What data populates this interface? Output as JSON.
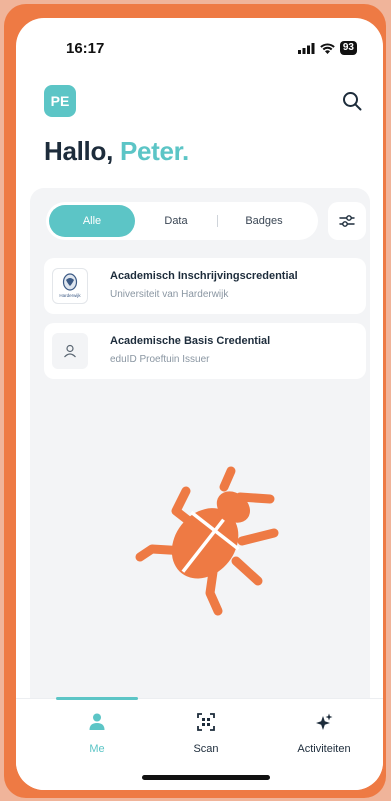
{
  "status_bar": {
    "time": "16:17",
    "battery": "93"
  },
  "header": {
    "avatar_initials": "PE",
    "greeting_prefix": "Hallo,",
    "greeting_name": "Peter."
  },
  "filters": {
    "tabs": [
      "Alle",
      "Data",
      "Badges"
    ],
    "active": "Alle"
  },
  "credentials": [
    {
      "title": "Academisch Inschrijvingscredential",
      "issuer": "Universiteit van Harderwijk",
      "logo_text": "Harderwijk"
    },
    {
      "title": "Academische Basis Credential",
      "issuer": "eduID Proeftuin Issuer"
    }
  ],
  "tab_bar": {
    "tabs": [
      "Me",
      "Scan",
      "Activiteiten"
    ],
    "active": "Me"
  },
  "colors": {
    "accent": "#5cc5c6",
    "frame": "#ee7a44",
    "bug": "#ee7a44"
  },
  "icons": [
    "search-icon",
    "filter-sliders-icon",
    "university-seal-icon",
    "person-icon",
    "bug-icon",
    "person-filled-icon",
    "scan-icon",
    "sparkle-icon"
  ]
}
